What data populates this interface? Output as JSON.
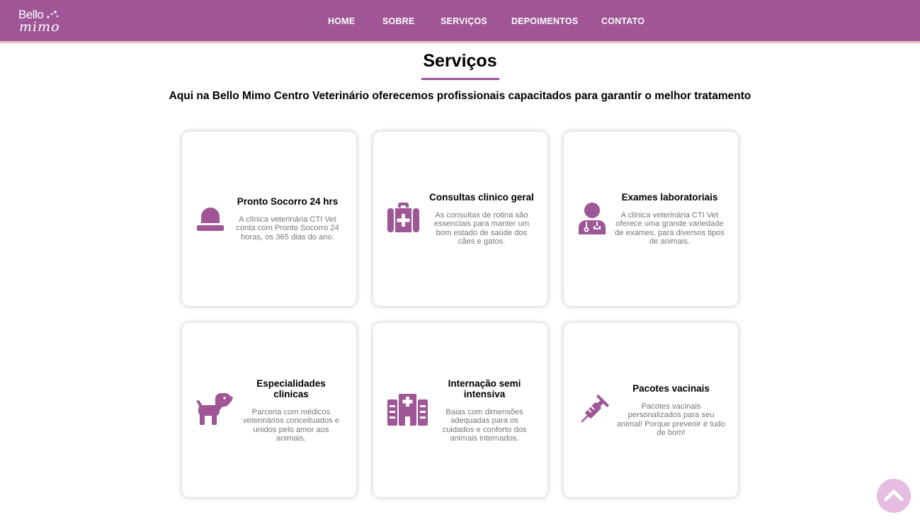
{
  "brand": {
    "line1": "Bello",
    "line2": "mimo"
  },
  "nav": [
    "HOME",
    "SOBRE",
    "SERVIÇOS",
    "DEPOIMENTOS",
    "CONTATO"
  ],
  "section": {
    "title": "Serviços",
    "subtitle": "Aqui na Bello Mimo Centro Veterinário oferecemos profissionais capacitados para garantir o melhor tratamento"
  },
  "services": [
    {
      "icon": "siren-icon",
      "title": "Pronto Socorro 24 hrs",
      "description": "A clínica veterinária CTI Vet conta com Pronto Socorro 24 horas, os 365 dias do ano."
    },
    {
      "icon": "medkit-icon",
      "title": "Consultas clinico geral",
      "description": "As consultas de rotina são essenciais para manter um bom estado de saúde dos cães e gatos."
    },
    {
      "icon": "doctor-icon",
      "title": "Exames laboratoriais",
      "description": "A clínica veterinária CTI Vet oferece uma grande variedade de exames, para diversos tipos de animais."
    },
    {
      "icon": "dog-icon",
      "title": "Especialidades clinicas",
      "description": "Parceria com médicos veterinários conceituados e unidos pelo amor aos animais."
    },
    {
      "icon": "hospital-icon",
      "title": "Internação semi intensiva",
      "description": "Baias com dimensões adequadas para os cuidados e conforto dos animais internados."
    },
    {
      "icon": "syringe-icon",
      "title": "Pacotes vacinais",
      "description": "Pacotes vacinais personalizados para seu animal! Porque prevenir é tudo de bom!"
    }
  ],
  "colors": {
    "primary": "#a05597",
    "accent_line": "#e8c0bc",
    "back_to_top": "#e6bce0"
  },
  "back_to_top_icon": "chevron-up-icon"
}
